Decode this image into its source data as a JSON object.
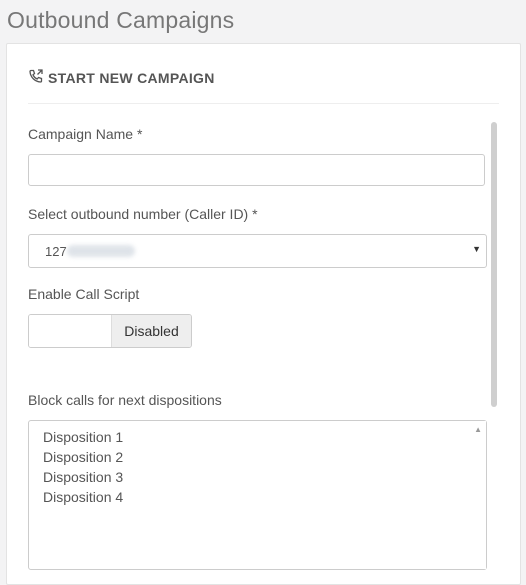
{
  "page": {
    "title": "Outbound Campaigns"
  },
  "panel": {
    "heading": "START NEW CAMPAIGN",
    "heading_icon": "phone-outgoing-icon"
  },
  "form": {
    "campaign_name": {
      "label": "Campaign Name *",
      "value": ""
    },
    "caller_id": {
      "label": "Select outbound number (Caller ID) *",
      "value": "127"
    },
    "call_script": {
      "label": "Enable Call Script",
      "state": "Disabled"
    },
    "block_dispositions": {
      "label": "Block calls for next dispositions",
      "options": [
        "Disposition 1",
        "Disposition 2",
        "Disposition 3",
        "Disposition 4"
      ]
    }
  }
}
